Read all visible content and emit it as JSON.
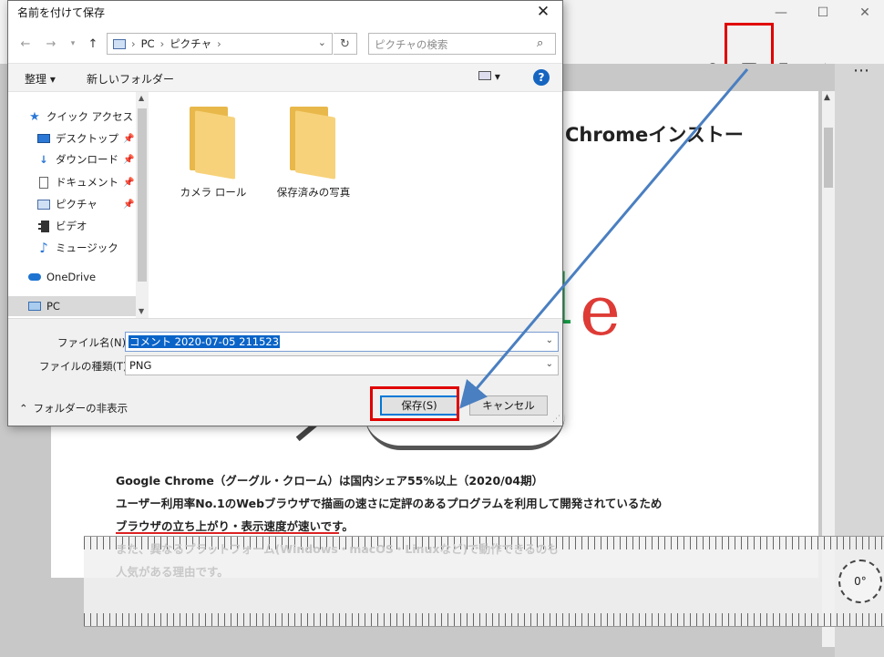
{
  "dialog": {
    "title": "名前を付けて保存",
    "address": {
      "segments": [
        "PC",
        "ピクチャ"
      ]
    },
    "search_placeholder": "ピクチャの検索",
    "commands": {
      "organize": "整理 ▾",
      "new_folder": "新しいフォルダー"
    },
    "nav_items": [
      {
        "label": "クイック アクセス"
      },
      {
        "label": "デスクトップ"
      },
      {
        "label": "ダウンロード"
      },
      {
        "label": "ドキュメント"
      },
      {
        "label": "ピクチャ"
      },
      {
        "label": "ビデオ"
      },
      {
        "label": "ミュージック"
      },
      {
        "label": "OneDrive"
      },
      {
        "label": "PC"
      }
    ],
    "folders": [
      {
        "label": "カメラ ロール"
      },
      {
        "label": "保存済みの写真"
      }
    ],
    "filename_label": "ファイル名(N):",
    "filename_value": "コメント 2020-07-05 211523",
    "filetype_label": "ファイルの種類(T):",
    "filetype_value": "PNG",
    "hide_folders": "フォルダーの非表示",
    "save_button": "保存(S)",
    "cancel_button": "キャンセル"
  },
  "document": {
    "heading": "Chromeインストー",
    "logo_letters": [
      "l",
      "e"
    ],
    "lines": [
      "Google Chrome（グーグル・クローム）は国内シェア55%以上（2020/04期）",
      "ユーザー利用率No.1のWebブラウザで描画の速さに定評のあるプログラムを利用して開発されているため",
      "ブラウザの立ち上がり・表示速度が速いです。",
      "また、異なるプラットフォーム(Windows・macOS・Linuxなど)で動作できるのも",
      "人気がある理由です。"
    ]
  },
  "ruler": {
    "angle": "0°"
  },
  "colors": {
    "highlight_red": "#e00000",
    "arrow_blue": "#4a7fc1",
    "selection_blue": "#0a64c8"
  }
}
